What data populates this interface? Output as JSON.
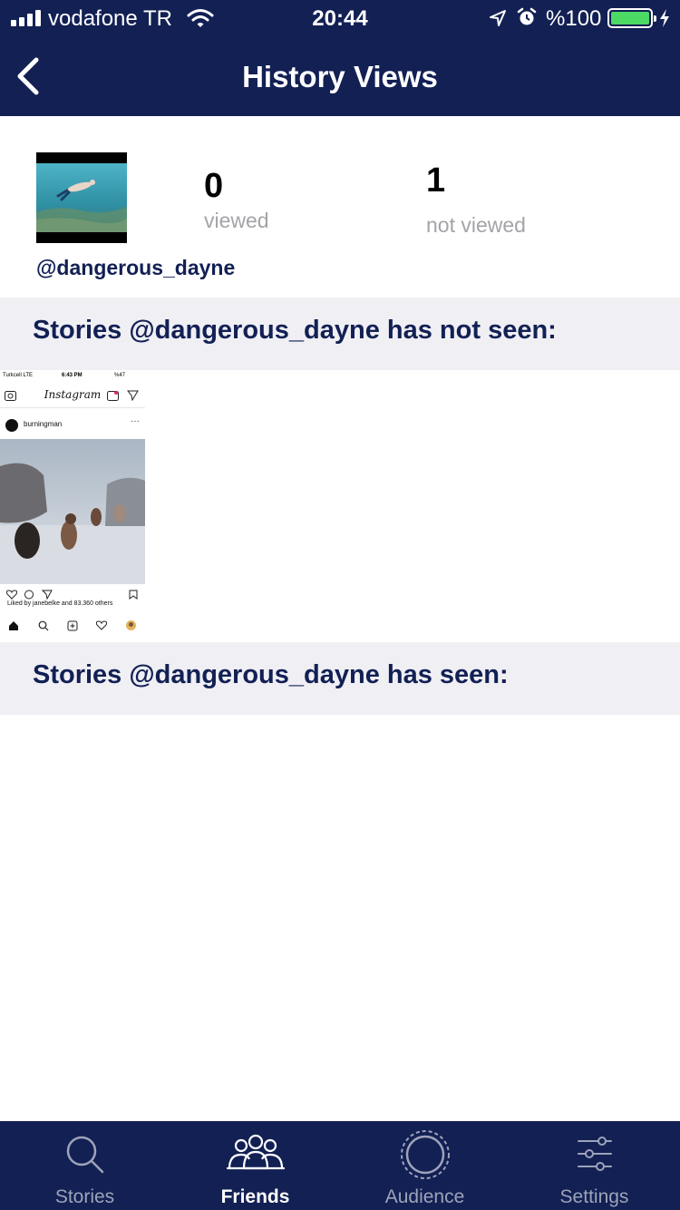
{
  "status_bar": {
    "carrier": "vodafone TR",
    "time": "20:44",
    "battery_text": "%100",
    "battery_level": 1.0
  },
  "nav": {
    "title": "History Views",
    "back_icon": "chevron-left-icon"
  },
  "profile": {
    "username": "@dangerous_dayne",
    "viewed_count": "0",
    "viewed_label": "viewed",
    "not_viewed_count": "1",
    "not_viewed_label": "not viewed"
  },
  "sections": {
    "not_seen_title": "Stories @dangerous_dayne has not seen:",
    "seen_title": "Stories @dangerous_dayne has seen:"
  },
  "story_thumbnail": {
    "status_carrier": "Turkcell  LTE",
    "status_time": "6:43 PM",
    "status_battery": "%47",
    "brand": "Instagram",
    "post_user": "burningman",
    "liked_text": "Liked by janebelke and 83.360 others"
  },
  "tabs": [
    {
      "label": "Stories",
      "icon": "search-icon",
      "active": false
    },
    {
      "label": "Friends",
      "icon": "friends-icon",
      "active": true
    },
    {
      "label": "Audience",
      "icon": "audience-icon",
      "active": false
    },
    {
      "label": "Settings",
      "icon": "sliders-icon",
      "active": false
    }
  ],
  "colors": {
    "navy": "#122054",
    "section_bg": "#efeff4",
    "muted_text": "#a3a3a8",
    "battery_green": "#4cd964"
  }
}
